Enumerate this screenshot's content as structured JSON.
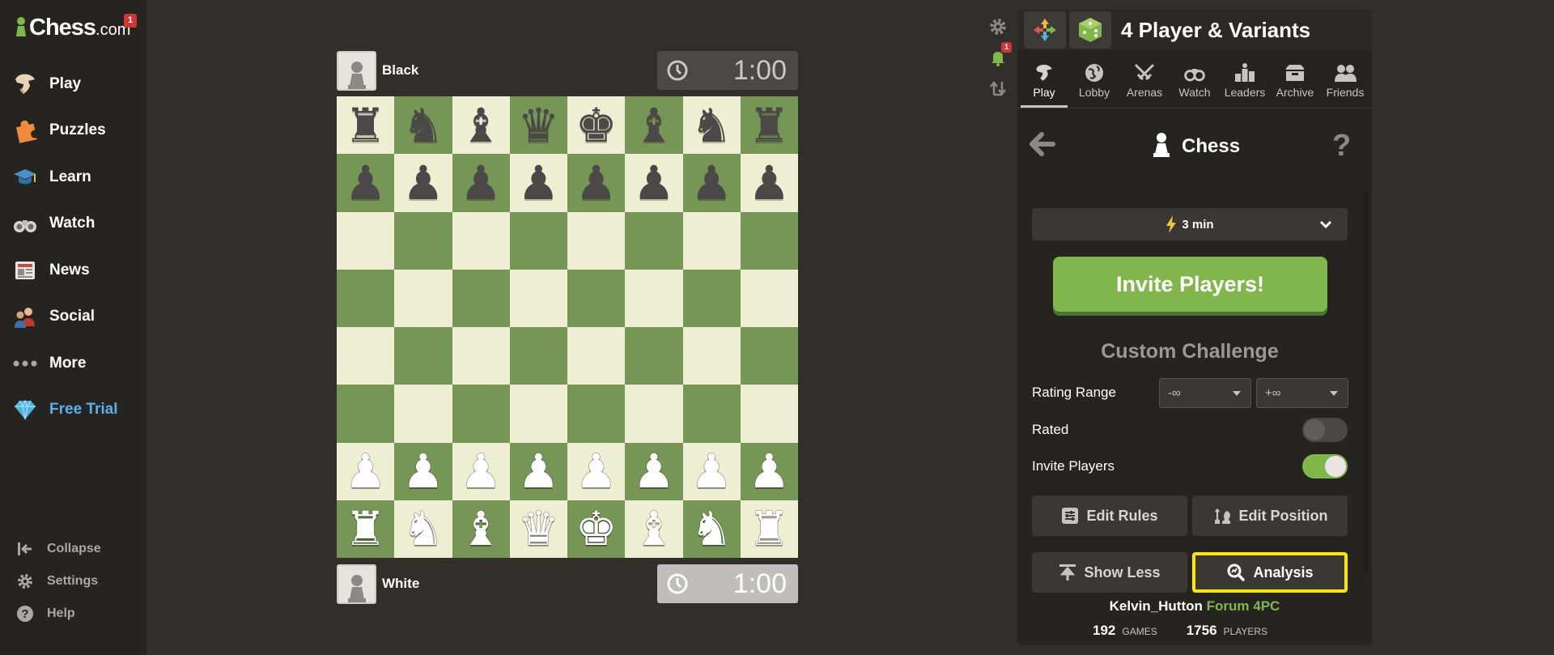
{
  "sidebar": {
    "logo_text": "Chess",
    "logo_suffix": ".com",
    "logo_badge": "1",
    "nav": [
      {
        "label": "Play",
        "icon": "play-hand-icon"
      },
      {
        "label": "Puzzles",
        "icon": "puzzle-icon"
      },
      {
        "label": "Learn",
        "icon": "graduation-cap-icon"
      },
      {
        "label": "Watch",
        "icon": "binoculars-icon"
      },
      {
        "label": "News",
        "icon": "newspaper-icon"
      },
      {
        "label": "Social",
        "icon": "people-icon"
      },
      {
        "label": "More",
        "icon": "ellipsis-icon"
      },
      {
        "label": "Free Trial",
        "icon": "diamond-icon"
      }
    ],
    "bottom": [
      {
        "label": "Collapse",
        "icon": "collapse-icon"
      },
      {
        "label": "Settings",
        "icon": "gear-icon"
      },
      {
        "label": "Help",
        "icon": "help-icon"
      }
    ]
  },
  "game": {
    "top_player": "Black",
    "bottom_player": "White",
    "top_clock": "1:00",
    "bottom_clock": "1:00",
    "board_colors": {
      "light": "#eeeed2",
      "dark": "#769656"
    },
    "position": [
      "rnbqkbnr",
      "pppppppp",
      "........",
      "........",
      "........",
      "........",
      "PPPPPPPP",
      "RNBQKBNR"
    ]
  },
  "side_tools": {
    "notification_badge": "1"
  },
  "panel": {
    "header_title": "4 Player & Variants",
    "tabs": [
      "Play",
      "Lobby",
      "Arenas",
      "Watch",
      "Leaders",
      "Archive",
      "Friends"
    ],
    "active_tab": "Play",
    "title": "Chess",
    "help_label": "?",
    "time_control": "3 min",
    "invite_button": "Invite Players!",
    "custom_title": "Custom Challenge",
    "rating_range_label": "Rating Range",
    "rating_min": "-∞",
    "rating_max": "+∞",
    "rated_label": "Rated",
    "rated_on": false,
    "invite_players_label": "Invite Players",
    "invite_players_on": true,
    "edit_rules": "Edit Rules",
    "edit_position": "Edit Position",
    "show_less": "Show Less",
    "analysis": "Analysis",
    "footer_user": "Kelvin_Hutton",
    "footer_link1": "Forum",
    "footer_link2": "4PC",
    "games_count": "192",
    "games_label": "GAMES",
    "players_count": "1756",
    "players_label": "PLAYERS",
    "accent_green": "#81b64c",
    "highlight_color": "#ffe600"
  }
}
